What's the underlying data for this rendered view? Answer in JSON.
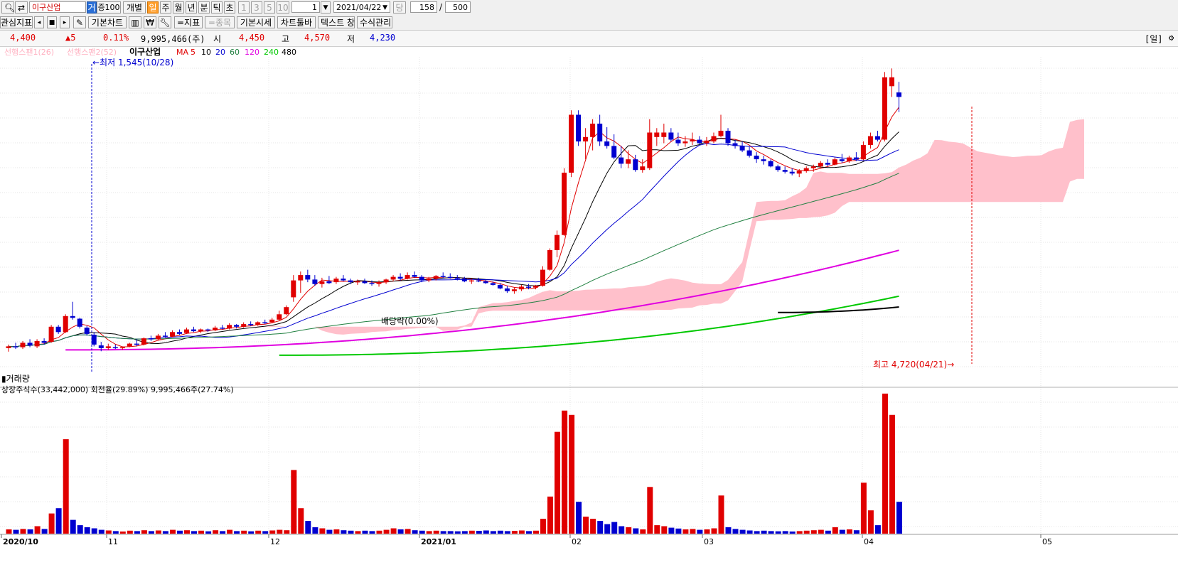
{
  "toolbar": {
    "stock_name": "이구산업",
    "margin_tag": "거",
    "margin_rate": "증100",
    "individual": "개별",
    "periods": [
      "일",
      "주",
      "월",
      "년",
      "분",
      "틱",
      "초"
    ],
    "period_selected": "일",
    "nums": [
      "1",
      "3",
      "5",
      "10"
    ],
    "interval_value": "1",
    "date": "2021/04/22",
    "date_flag": "당",
    "count": "158",
    "separator": "/",
    "total": "500",
    "indicator": "관심지표",
    "basic_chart": "기본차트",
    "indicators_btn": "=지표",
    "symbols_btn": "=종목",
    "basic_quote": "기본시세",
    "chart_toolbar": "차트툴바",
    "text_window": "텍스트 창",
    "formula_mgmt": "수식관리"
  },
  "quote": {
    "price": "4,400",
    "change": "▲5",
    "rate": "0.11%",
    "volume": "9,995,466(주)",
    "open_label": "시",
    "open": "4,450",
    "high_label": "고",
    "high": "4,570",
    "low_label": "저",
    "low": "4,230",
    "period_tag": "[일]"
  },
  "legend": {
    "span1": "선행스팬1(26)",
    "span2": "선행스팬2(52)",
    "name": "이구산업",
    "ma_label": "MA",
    "ma": [
      {
        "p": "5",
        "c": "#e00000"
      },
      {
        "p": "10",
        "c": "#000000"
      },
      {
        "p": "20",
        "c": "#0000d0"
      },
      {
        "p": "60",
        "c": "#208040"
      },
      {
        "p": "120",
        "c": "#e000e0"
      },
      {
        "p": "240",
        "c": "#00c800"
      },
      {
        "p": "480",
        "c": "#000000"
      }
    ]
  },
  "annotations": {
    "low": "←최저 1,545(10/28)",
    "high": "최고 4,720(04/21)→",
    "dividend": "배당락(0.00%)"
  },
  "volume_panel": {
    "title": "거래량",
    "stats": "상장주식수(33,442,000) 회전율(29.89%) 9,995,466주(27.74%)"
  },
  "colors": {
    "up": "#e00000",
    "down": "#0000d0",
    "cloud": "#ffc0cb"
  },
  "chart_data": {
    "type": "candlestick",
    "x_axis_labels": [
      "2020/10",
      "11",
      "12",
      "2021/01",
      "02",
      "03",
      "04",
      "05"
    ],
    "candles": [
      [
        1580,
        1620,
        1540,
        1600,
        "up",
        20
      ],
      [
        1600,
        1640,
        1570,
        1590,
        "down",
        18
      ],
      [
        1590,
        1660,
        1570,
        1640,
        "up",
        22
      ],
      [
        1640,
        1680,
        1590,
        1610,
        "down",
        20
      ],
      [
        1600,
        1680,
        1580,
        1660,
        "up",
        35
      ],
      [
        1660,
        1690,
        1620,
        1640,
        "down",
        22
      ],
      [
        1650,
        1840,
        1640,
        1820,
        "up",
        95
      ],
      [
        1820,
        1840,
        1740,
        1760,
        "down",
        120
      ],
      [
        1760,
        1960,
        1750,
        1940,
        "up",
        445
      ],
      [
        1940,
        2100,
        1900,
        1920,
        "down",
        65
      ],
      [
        1910,
        1920,
        1800,
        1820,
        "down",
        40
      ],
      [
        1810,
        1830,
        1720,
        1740,
        "down",
        30
      ],
      [
        1730,
        1760,
        1600,
        1620,
        "down",
        25
      ],
      [
        1610,
        1650,
        1545,
        1580,
        "down",
        18
      ],
      [
        1580,
        1630,
        1560,
        1600,
        "up",
        15
      ],
      [
        1590,
        1620,
        1570,
        1580,
        "down",
        12
      ],
      [
        1580,
        1600,
        1560,
        1590,
        "up",
        10
      ],
      [
        1600,
        1640,
        1590,
        1630,
        "up",
        14
      ],
      [
        1630,
        1680,
        1600,
        1620,
        "down",
        12
      ],
      [
        1620,
        1700,
        1610,
        1690,
        "up",
        16
      ],
      [
        1690,
        1720,
        1660,
        1680,
        "down",
        12
      ],
      [
        1680,
        1740,
        1670,
        1720,
        "up",
        15
      ],
      [
        1720,
        1760,
        1700,
        1710,
        "down",
        12
      ],
      [
        1710,
        1780,
        1700,
        1760,
        "up",
        18
      ],
      [
        1760,
        1790,
        1730,
        1740,
        "down",
        14
      ],
      [
        1750,
        1810,
        1740,
        1790,
        "up",
        16
      ],
      [
        1790,
        1820,
        1760,
        1770,
        "down",
        12
      ],
      [
        1770,
        1800,
        1750,
        1790,
        "up",
        14
      ],
      [
        1790,
        1800,
        1760,
        1780,
        "down",
        11
      ],
      [
        1780,
        1830,
        1770,
        1810,
        "up",
        16
      ],
      [
        1810,
        1840,
        1790,
        1800,
        "down",
        12
      ],
      [
        1800,
        1860,
        1790,
        1840,
        "up",
        18
      ],
      [
        1840,
        1850,
        1800,
        1820,
        "down",
        12
      ],
      [
        1820,
        1870,
        1810,
        1850,
        "up",
        14
      ],
      [
        1850,
        1880,
        1830,
        1840,
        "down",
        11
      ],
      [
        1840,
        1880,
        1830,
        1870,
        "up",
        14
      ],
      [
        1870,
        1900,
        1850,
        1860,
        "down",
        12
      ],
      [
        1870,
        1920,
        1860,
        1900,
        "up",
        15
      ],
      [
        1900,
        2000,
        1890,
        1960,
        "up",
        18
      ],
      [
        1960,
        2060,
        1950,
        2040,
        "up",
        16
      ],
      [
        2150,
        2400,
        2100,
        2340,
        "up",
        300
      ],
      [
        2340,
        2440,
        2200,
        2400,
        "up",
        120
      ],
      [
        2400,
        2460,
        2320,
        2350,
        "down",
        60
      ],
      [
        2350,
        2400,
        2280,
        2300,
        "down",
        30
      ],
      [
        2300,
        2370,
        2260,
        2330,
        "up",
        25
      ],
      [
        2330,
        2390,
        2300,
        2310,
        "down",
        18
      ],
      [
        2320,
        2380,
        2300,
        2360,
        "up",
        20
      ],
      [
        2360,
        2400,
        2330,
        2340,
        "down",
        16
      ],
      [
        2340,
        2360,
        2300,
        2320,
        "down",
        14
      ],
      [
        2320,
        2350,
        2290,
        2330,
        "up",
        12
      ],
      [
        2330,
        2360,
        2300,
        2310,
        "down",
        14
      ],
      [
        2310,
        2340,
        2280,
        2300,
        "down",
        12
      ],
      [
        2300,
        2340,
        2270,
        2320,
        "up",
        14
      ],
      [
        2320,
        2360,
        2300,
        2350,
        "up",
        18
      ],
      [
        2350,
        2400,
        2330,
        2380,
        "up",
        25
      ],
      [
        2380,
        2420,
        2340,
        2360,
        "down",
        20
      ],
      [
        2360,
        2430,
        2350,
        2400,
        "up",
        22
      ],
      [
        2400,
        2440,
        2370,
        2380,
        "down",
        16
      ],
      [
        2380,
        2400,
        2320,
        2340,
        "down",
        14
      ],
      [
        2340,
        2380,
        2320,
        2360,
        "up",
        12
      ],
      [
        2360,
        2400,
        2340,
        2390,
        "up",
        14
      ],
      [
        2390,
        2430,
        2360,
        2380,
        "down",
        12
      ],
      [
        2380,
        2420,
        2360,
        2370,
        "down",
        12
      ],
      [
        2370,
        2400,
        2340,
        2360,
        "down",
        11
      ],
      [
        2360,
        2380,
        2320,
        2330,
        "down",
        12
      ],
      [
        2330,
        2360,
        2300,
        2340,
        "up",
        14
      ],
      [
        2340,
        2370,
        2320,
        2330,
        "down",
        13
      ],
      [
        2330,
        2350,
        2300,
        2310,
        "down",
        15
      ],
      [
        2310,
        2330,
        2280,
        2290,
        "down",
        12
      ],
      [
        2290,
        2310,
        2240,
        2250,
        "down",
        14
      ],
      [
        2250,
        2280,
        2200,
        2220,
        "down",
        12
      ],
      [
        2220,
        2260,
        2190,
        2240,
        "up",
        13
      ],
      [
        2240,
        2290,
        2220,
        2270,
        "up",
        15
      ],
      [
        2270,
        2300,
        2240,
        2260,
        "down",
        12
      ],
      [
        2260,
        2290,
        2240,
        2280,
        "up",
        14
      ],
      [
        2280,
        2500,
        2270,
        2460,
        "up",
        70
      ],
      [
        2460,
        2700,
        2450,
        2680,
        "up",
        175
      ],
      [
        2680,
        2900,
        2600,
        2850,
        "up",
        480
      ],
      [
        2850,
        3600,
        2840,
        3550,
        "up",
        580
      ],
      [
        3550,
        4250,
        3500,
        4200,
        "up",
        560
      ],
      [
        4200,
        4250,
        3850,
        3900,
        "down",
        150
      ],
      [
        3900,
        4050,
        3700,
        3950,
        "up",
        80
      ],
      [
        3950,
        4150,
        3800,
        4100,
        "up",
        70
      ],
      [
        4100,
        4200,
        3850,
        3900,
        "down",
        60
      ],
      [
        3900,
        4060,
        3820,
        3850,
        "down",
        45
      ],
      [
        3850,
        3980,
        3700,
        3720,
        "down",
        55
      ],
      [
        3720,
        3850,
        3600,
        3650,
        "down",
        35
      ],
      [
        3650,
        3800,
        3600,
        3700,
        "up",
        30
      ],
      [
        3700,
        3750,
        3560,
        3580,
        "down",
        25
      ],
      [
        3580,
        3700,
        3550,
        3620,
        "up",
        20
      ],
      [
        3600,
        4150,
        3580,
        4000,
        "up",
        220
      ],
      [
        4000,
        4050,
        3850,
        3950,
        "up",
        40
      ],
      [
        3950,
        4100,
        3880,
        4000,
        "up",
        35
      ],
      [
        4000,
        4050,
        3900,
        3920,
        "down",
        28
      ],
      [
        3920,
        4000,
        3850,
        3880,
        "down",
        24
      ],
      [
        3880,
        3960,
        3840,
        3900,
        "up",
        20
      ],
      [
        3900,
        4000,
        3860,
        3920,
        "up",
        22
      ],
      [
        3920,
        3960,
        3870,
        3880,
        "down",
        18
      ],
      [
        3880,
        3950,
        3850,
        3910,
        "up",
        20
      ],
      [
        3900,
        4000,
        3880,
        3960,
        "up",
        25
      ],
      [
        3960,
        4200,
        3950,
        4020,
        "up",
        180
      ],
      [
        4020,
        4050,
        3850,
        3880,
        "down",
        30
      ],
      [
        3880,
        3920,
        3820,
        3850,
        "down",
        22
      ],
      [
        3850,
        3900,
        3780,
        3800,
        "down",
        18
      ],
      [
        3800,
        3840,
        3720,
        3740,
        "down",
        15
      ],
      [
        3740,
        3780,
        3660,
        3700,
        "down",
        12
      ],
      [
        3700,
        3740,
        3640,
        3680,
        "down",
        14
      ],
      [
        3680,
        3700,
        3610,
        3620,
        "down",
        12
      ],
      [
        3620,
        3640,
        3560,
        3580,
        "down",
        11
      ],
      [
        3580,
        3620,
        3540,
        3560,
        "down",
        12
      ],
      [
        3560,
        3600,
        3520,
        3540,
        "down",
        10
      ],
      [
        3540,
        3590,
        3500,
        3570,
        "up",
        12
      ],
      [
        3570,
        3620,
        3550,
        3600,
        "up",
        14
      ],
      [
        3600,
        3640,
        3560,
        3620,
        "up",
        16
      ],
      [
        3620,
        3680,
        3600,
        3660,
        "up",
        18
      ],
      [
        3660,
        3700,
        3620,
        3640,
        "down",
        14
      ],
      [
        3640,
        3720,
        3630,
        3700,
        "up",
        30
      ],
      [
        3700,
        3760,
        3660,
        3680,
        "down",
        18
      ],
      [
        3680,
        3740,
        3660,
        3720,
        "up",
        20
      ],
      [
        3720,
        3780,
        3680,
        3700,
        "down",
        16
      ],
      [
        3700,
        3900,
        3690,
        3860,
        "up",
        240
      ],
      [
        3860,
        4000,
        3820,
        3960,
        "up",
        110
      ],
      [
        3960,
        4020,
        3900,
        3920,
        "down",
        40
      ],
      [
        3920,
        4680,
        3900,
        4620,
        "up",
        660
      ],
      [
        4620,
        4720,
        4400,
        4520,
        "up",
        560
      ],
      [
        4450,
        4570,
        4230,
        4400,
        "down",
        150
      ]
    ],
    "ma_lines": [
      "MA 5",
      "10",
      "20",
      "60",
      "120",
      "240",
      "480"
    ],
    "ichimoku": [
      "선행스팬1(26)",
      "선행스팬2(52)"
    ],
    "volume_unit": "주"
  }
}
